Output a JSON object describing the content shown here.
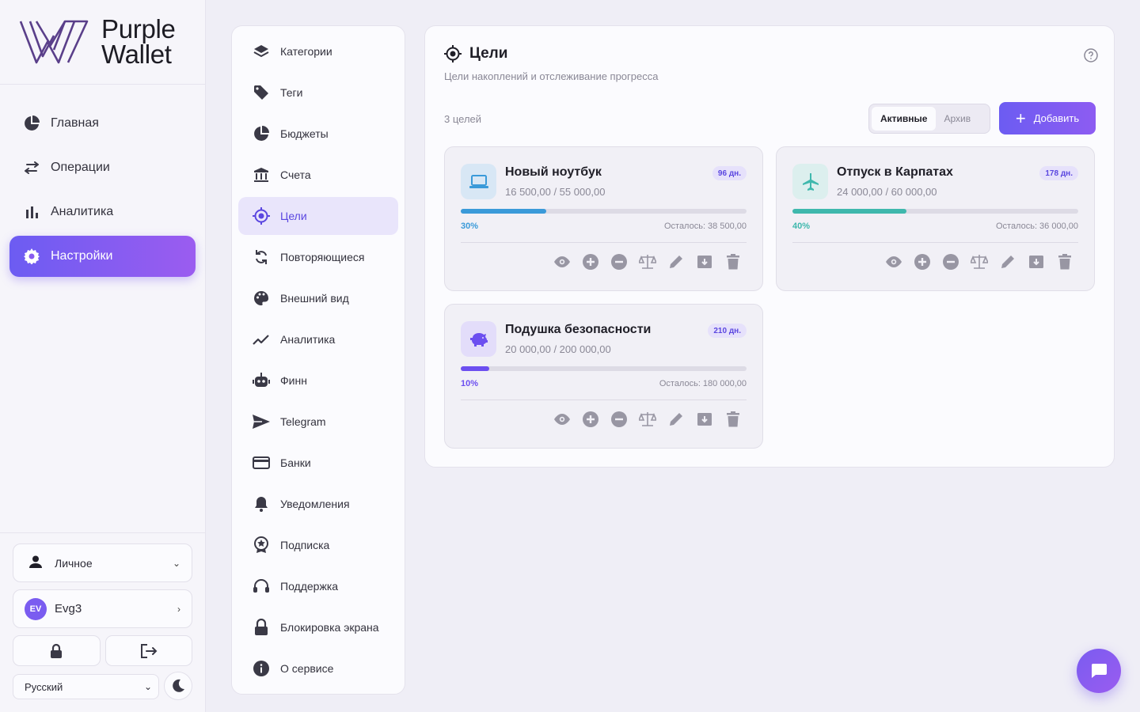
{
  "brand": {
    "line1": "Purple",
    "line2": "Wallet",
    "accent": "#7b5cf0"
  },
  "nav": {
    "items": [
      {
        "label": "Главная",
        "icon": "pie-chart-icon"
      },
      {
        "label": "Операции",
        "icon": "swap-arrows-icon"
      },
      {
        "label": "Аналитика",
        "icon": "bar-chart-icon"
      },
      {
        "label": "Настройки",
        "icon": "gear-icon",
        "active": true
      }
    ]
  },
  "account": {
    "profile_label": "Личное",
    "user_initials": "EV",
    "user_name": "Evg3",
    "language": "Русский"
  },
  "settings_menu": {
    "items": [
      {
        "label": "Категории",
        "icon": "layers-icon"
      },
      {
        "label": "Теги",
        "icon": "tag-icon"
      },
      {
        "label": "Бюджеты",
        "icon": "pie-chart-icon"
      },
      {
        "label": "Счета",
        "icon": "bank-icon"
      },
      {
        "label": "Цели",
        "icon": "target-icon",
        "active": true
      },
      {
        "label": "Повторяющиеся",
        "icon": "repeat-icon"
      },
      {
        "label": "Внешний вид",
        "icon": "palette-icon"
      },
      {
        "label": "Аналитика",
        "icon": "trend-icon"
      },
      {
        "label": "Финн",
        "icon": "robot-icon"
      },
      {
        "label": "Telegram",
        "icon": "send-icon"
      },
      {
        "label": "Банки",
        "icon": "card-icon"
      },
      {
        "label": "Уведомления",
        "icon": "bell-icon"
      },
      {
        "label": "Подписка",
        "icon": "badge-icon"
      },
      {
        "label": "Поддержка",
        "icon": "headset-icon"
      },
      {
        "label": "Блокировка экрана",
        "icon": "lock-icon"
      },
      {
        "label": "О сервисе",
        "icon": "info-icon"
      }
    ]
  },
  "goals_panel": {
    "title": "Цели",
    "subtitle": "Цели накоплений и отслеживание прогресса",
    "count_text": "3 целей",
    "tab_active": "Активные",
    "tab_archive": "Архив",
    "add_label": "Добавить"
  },
  "goals": [
    {
      "name": "Новый ноутбук",
      "amount": "16 500,00 / 55 000,00",
      "days": "96 дн.",
      "percent_text": "30%",
      "progress": 0.3,
      "remaining": "Осталось: 38 500,00",
      "icon": "laptop-icon",
      "color": "#3a9ad9",
      "icon_bg": "#d8e7f5"
    },
    {
      "name": "Отпуск в Карпатах",
      "amount": "24 000,00 / 60 000,00",
      "days": "178 дн.",
      "percent_text": "40%",
      "progress": 0.4,
      "remaining": "Осталось: 36 000,00",
      "icon": "airplane-icon",
      "color": "#3fb8ad",
      "icon_bg": "#dcefee"
    },
    {
      "name": "Подушка безопасности",
      "amount": "20 000,00 / 200 000,00",
      "days": "210 дн.",
      "percent_text": "10%",
      "progress": 0.1,
      "remaining": "Осталось: 180 000,00",
      "icon": "piggy-bank-icon",
      "color": "#6c4ff0",
      "icon_bg": "#e3ddfa"
    }
  ]
}
